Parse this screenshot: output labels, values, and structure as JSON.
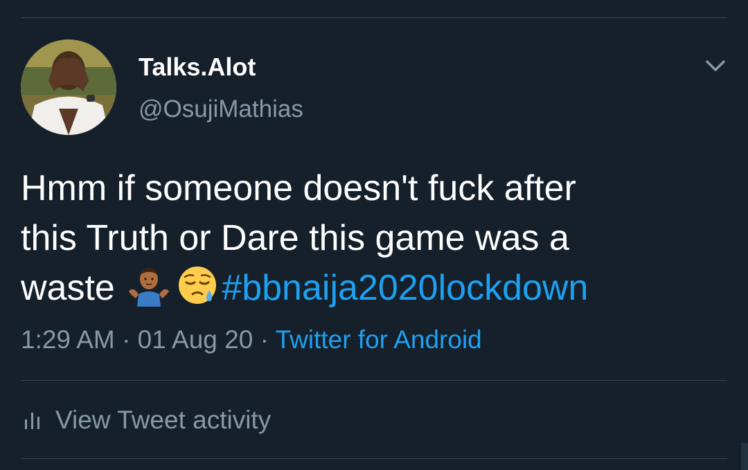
{
  "user": {
    "display_name": "Talks.Alot",
    "handle": "@OsujiMathias"
  },
  "tweet": {
    "line1": "Hmm  if someone doesn't fuck  after",
    "line2": "this Truth or Dare this game was a",
    "line3_prefix": "waste",
    "hashtag": "#bbnaija2020lockdown",
    "emojis": [
      "man-shrugging-icon",
      "sleepy-face-icon"
    ]
  },
  "meta": {
    "time": "1:29 AM",
    "separator": "·",
    "date": "01 Aug 20",
    "source": "Twitter for Android"
  },
  "activity": {
    "label": "View Tweet activity"
  },
  "colors": {
    "background": "#15202b",
    "text": "#ffffff",
    "secondary": "#8899a6",
    "link": "#1da1f2",
    "divider": "#38444d"
  }
}
